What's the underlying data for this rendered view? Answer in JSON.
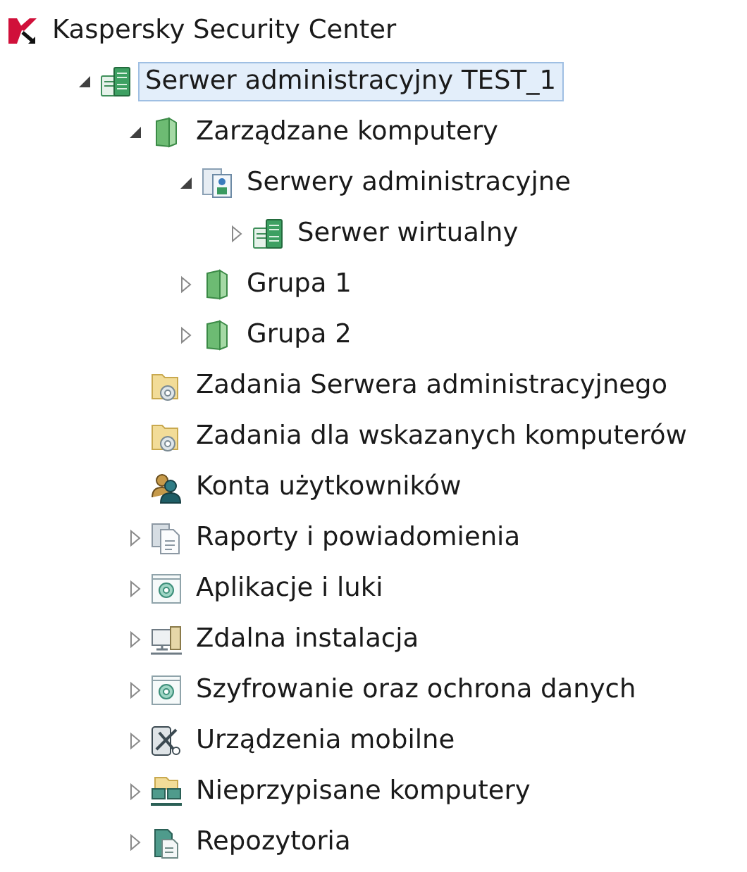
{
  "tree": [
    {
      "label": "Kaspersky Security Center",
      "kind": "logo",
      "selected": false,
      "children": [
        {
          "label": "Serwer administracyjny TEST_1",
          "kind": "server",
          "selected": true,
          "expanded": true,
          "children": [
            {
              "label": "Zarządzane komputery",
              "kind": "folder",
              "selected": false,
              "expanded": true,
              "children": [
                {
                  "label": "Serwery administracyjne",
                  "kind": "server-group",
                  "selected": false,
                  "expanded": true,
                  "children": [
                    {
                      "label": "Serwer wirtualny",
                      "kind": "server",
                      "selected": false,
                      "expanded": false
                    }
                  ]
                },
                {
                  "label": "Grupa 1",
                  "kind": "folder",
                  "selected": false,
                  "expanded": false
                },
                {
                  "label": "Grupa 2",
                  "kind": "folder",
                  "selected": false,
                  "expanded": false
                }
              ]
            },
            {
              "label": "Zadania Serwera administracyjnego",
              "kind": "task-folder",
              "selected": false
            },
            {
              "label": "Zadania dla wskazanych komputerów",
              "kind": "task-folder",
              "selected": false
            },
            {
              "label": "Konta użytkowników",
              "kind": "users",
              "selected": false
            },
            {
              "label": "Raporty i powiadomienia",
              "kind": "reports",
              "selected": false,
              "expanded": false
            },
            {
              "label": "Aplikacje i luki",
              "kind": "gear-window",
              "selected": false,
              "expanded": false
            },
            {
              "label": "Zdalna instalacja",
              "kind": "install",
              "selected": false,
              "expanded": false
            },
            {
              "label": "Szyfrowanie oraz ochrona danych",
              "kind": "gear-window",
              "selected": false,
              "expanded": false
            },
            {
              "label": "Urządzenia mobilne",
              "kind": "mobile",
              "selected": false,
              "expanded": false
            },
            {
              "label": "Nieprzypisane komputery",
              "kind": "unassigned",
              "selected": false,
              "expanded": false
            },
            {
              "label": "Repozytoria",
              "kind": "repository",
              "selected": false,
              "expanded": false
            }
          ]
        }
      ]
    }
  ]
}
